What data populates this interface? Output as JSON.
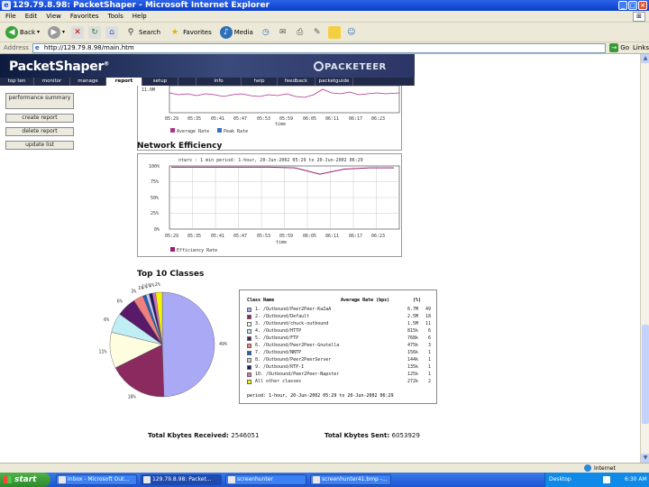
{
  "window": {
    "title": "129.79.8.98: PacketShaper - Microsoft Internet Explorer"
  },
  "menu": [
    "File",
    "Edit",
    "View",
    "Favorites",
    "Tools",
    "Help"
  ],
  "toolbar": {
    "back": "Back",
    "search": "Search",
    "favorites": "Favorites",
    "media": "Media"
  },
  "address": {
    "label": "Address",
    "url": "http://129.79.8.98/main.htm",
    "go": "Go",
    "links": "Links"
  },
  "ps": {
    "logo": "PacketShaper",
    "brand": "PACKETEER",
    "nav": [
      "top ten",
      "monitor",
      "manage",
      "report",
      "setup",
      "info",
      "help",
      "feedback",
      "packetguide"
    ],
    "active_tab": "report"
  },
  "sidebar": [
    "performance summary",
    "create report",
    "delete report",
    "update list"
  ],
  "charts": {
    "rate": {
      "ytick": "11.0M",
      "xticks": [
        "05:29",
        "05:35",
        "05:41",
        "05:47",
        "05:53",
        "05:59",
        "06:05",
        "06:11",
        "06:17",
        "06:23"
      ],
      "xlabel": "time",
      "legend": [
        "Average Rate",
        "Peak Rate"
      ],
      "colors": [
        "#b0308a",
        "#3a70c8"
      ]
    },
    "efficiency": {
      "title": "Network Efficiency",
      "header": "ntwrx : 1 min  period: 1-hour, 20-Jun-2002 05:29 to 20-Jun-2002 06:29",
      "yticks": [
        "100%",
        "75%",
        "50%",
        "25%",
        "0%"
      ],
      "xticks": [
        "05:29",
        "05:35",
        "05:41",
        "05:47",
        "05:53",
        "05:59",
        "06:05",
        "06:11",
        "06:17",
        "06:23"
      ],
      "xlabel": "time",
      "legend": "Efficiency Rate",
      "color": "#9a1c72"
    }
  },
  "top10": {
    "title": "Top 10 Classes",
    "headers": {
      "name": "Class Name",
      "rate": "Average Rate (bps)",
      "pct": "(%)"
    },
    "rows": [
      {
        "name": "1. /Outbound/Peer2Peer-KaZaA",
        "rate": "6.7M",
        "pct": "49",
        "color": "#a9a9f5"
      },
      {
        "name": "2. /Outbound/Default",
        "rate": "2.5M",
        "pct": "18",
        "color": "#8a2a5e"
      },
      {
        "name": "3. /Outbound/chuck-outbound",
        "rate": "1.5M",
        "pct": "11",
        "color": "#fffde0"
      },
      {
        "name": "4. /Outbound/HTTP",
        "rate": "815k",
        "pct": "6",
        "color": "#bfeef5"
      },
      {
        "name": "5. /Outbound/FTP",
        "rate": "768k",
        "pct": "6",
        "color": "#5a1a6a"
      },
      {
        "name": "6. /Outbound/Peer2Peer-Gnutella",
        "rate": "475k",
        "pct": "3",
        "color": "#f08080"
      },
      {
        "name": "7. /Outbound/NNTP",
        "rate": "156k",
        "pct": "1",
        "color": "#1c62b8"
      },
      {
        "name": "8. /Outbound/Peer2PeerServer",
        "rate": "144k",
        "pct": "1",
        "color": "#c9c9f0"
      },
      {
        "name": "9. /Outbound/RTP-I",
        "rate": "135k",
        "pct": "1",
        "color": "#1b1b60"
      },
      {
        "name": "10. /Outbound/Peer2Peer-Napster",
        "rate": "125k",
        "pct": "1",
        "color": "#e066d0"
      },
      {
        "name": "All other classes",
        "rate": "272k",
        "pct": "2",
        "color": "#f5f500"
      }
    ],
    "period": "period: 1-hour, 20-Jun-2002 05:29 to 20-Jun-2002 06:29",
    "pie_labels": [
      "49%",
      "18%",
      "11%",
      "6%",
      "6%",
      "3%",
      "1%",
      "1%",
      "1%",
      "1%",
      "2%"
    ]
  },
  "totals": {
    "received_label": "Total Kbytes Received:",
    "received": "2546051",
    "sent_label": "Total Kbytes Sent:",
    "sent": "6053929"
  },
  "status": {
    "zone": "Internet"
  },
  "taskbar": {
    "start": "start",
    "tasks": [
      "Inbox - Microsoft Out...",
      "129.79.8.98: Packet...",
      "screenhunter",
      "screenhunter41.bmp -..."
    ],
    "tray": [
      "Desktop",
      "6:30 AM"
    ]
  },
  "chart_data": [
    {
      "type": "line",
      "title": "Network Efficiency",
      "xlabel": "time",
      "ylabel": "",
      "x": [
        "05:29",
        "05:35",
        "05:41",
        "05:47",
        "05:53",
        "05:59",
        "06:05",
        "06:11",
        "06:17",
        "06:23"
      ],
      "ylim": [
        0,
        100
      ],
      "series": [
        {
          "name": "Efficiency Rate",
          "values": [
            98,
            98,
            98,
            98,
            98,
            97,
            87,
            95,
            97,
            97
          ]
        }
      ],
      "grid": true,
      "legend": "bottom-left"
    },
    {
      "type": "pie",
      "title": "Top 10 Classes",
      "categories": [
        "1. /Outbound/Peer2Peer-KaZaA",
        "2. /Outbound/Default",
        "3. /Outbound/chuck-outbound",
        "4. /Outbound/HTTP",
        "5. /Outbound/FTP",
        "6. /Outbound/Peer2Peer-Gnutella",
        "7. /Outbound/NNTP",
        "8. /Outbound/Peer2PeerServer",
        "9. /Outbound/RTP-I",
        "10. /Outbound/Peer2Peer-Napster",
        "All other classes"
      ],
      "values": [
        49,
        18,
        11,
        6,
        6,
        3,
        1,
        1,
        1,
        1,
        2
      ]
    }
  ]
}
